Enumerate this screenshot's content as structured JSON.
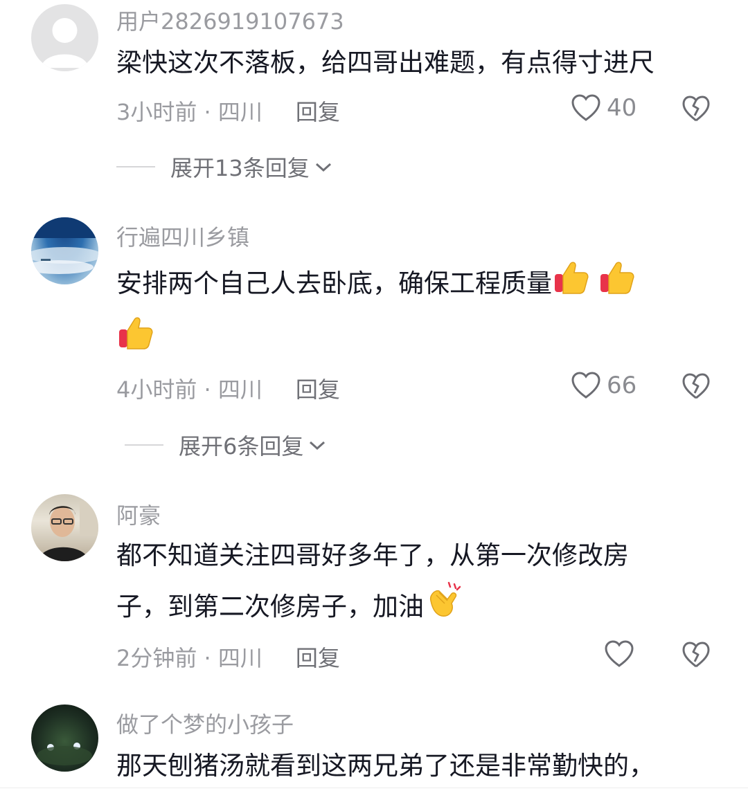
{
  "comments": [
    {
      "username": "用户2826919107673",
      "text_lines": [
        "梁快这次不落板，给四哥出难题，有点得寸进尺"
      ],
      "time_location": "3小时前 · 四川",
      "reply_label": "回复",
      "likes": "40",
      "expand_label": "展开13条回复",
      "avatar_icon": "default-avatar-icon"
    },
    {
      "username": "行遍四川乡镇",
      "text_lines": [
        "安排两个自己人去卧底，确保工程质量"
      ],
      "time_location": "4小时前 · 四川",
      "reply_label": "回复",
      "likes": "66",
      "expand_label": "展开6条回复",
      "avatar_icon": "landscape-avatar-icon"
    },
    {
      "username": "阿豪",
      "text_lines": [
        "都不知道关注四哥好多年了，从第一次修改房",
        "子，到第二次修房子，加油"
      ],
      "time_location": "2分钟前 · 四川",
      "reply_label": "回复",
      "likes": "",
      "avatar_icon": "person-avatar-icon"
    },
    {
      "username": "做了个梦的小孩子",
      "text_lines": [
        "那天刨猪汤就看到这两兄弟了还是非常勤快的，"
      ],
      "avatar_icon": "night-avatar-icon"
    }
  ],
  "icons": {
    "like": "heart-outline-icon",
    "dislike": "broken-heart-icon",
    "expand": "chevron-down-icon",
    "thumbs_up": "thumbs-up-emoji",
    "clap": "clapping-hands-emoji"
  },
  "colors": {
    "text": "#161823",
    "muted": "#9a9ba0",
    "reply": "#6f7076"
  }
}
